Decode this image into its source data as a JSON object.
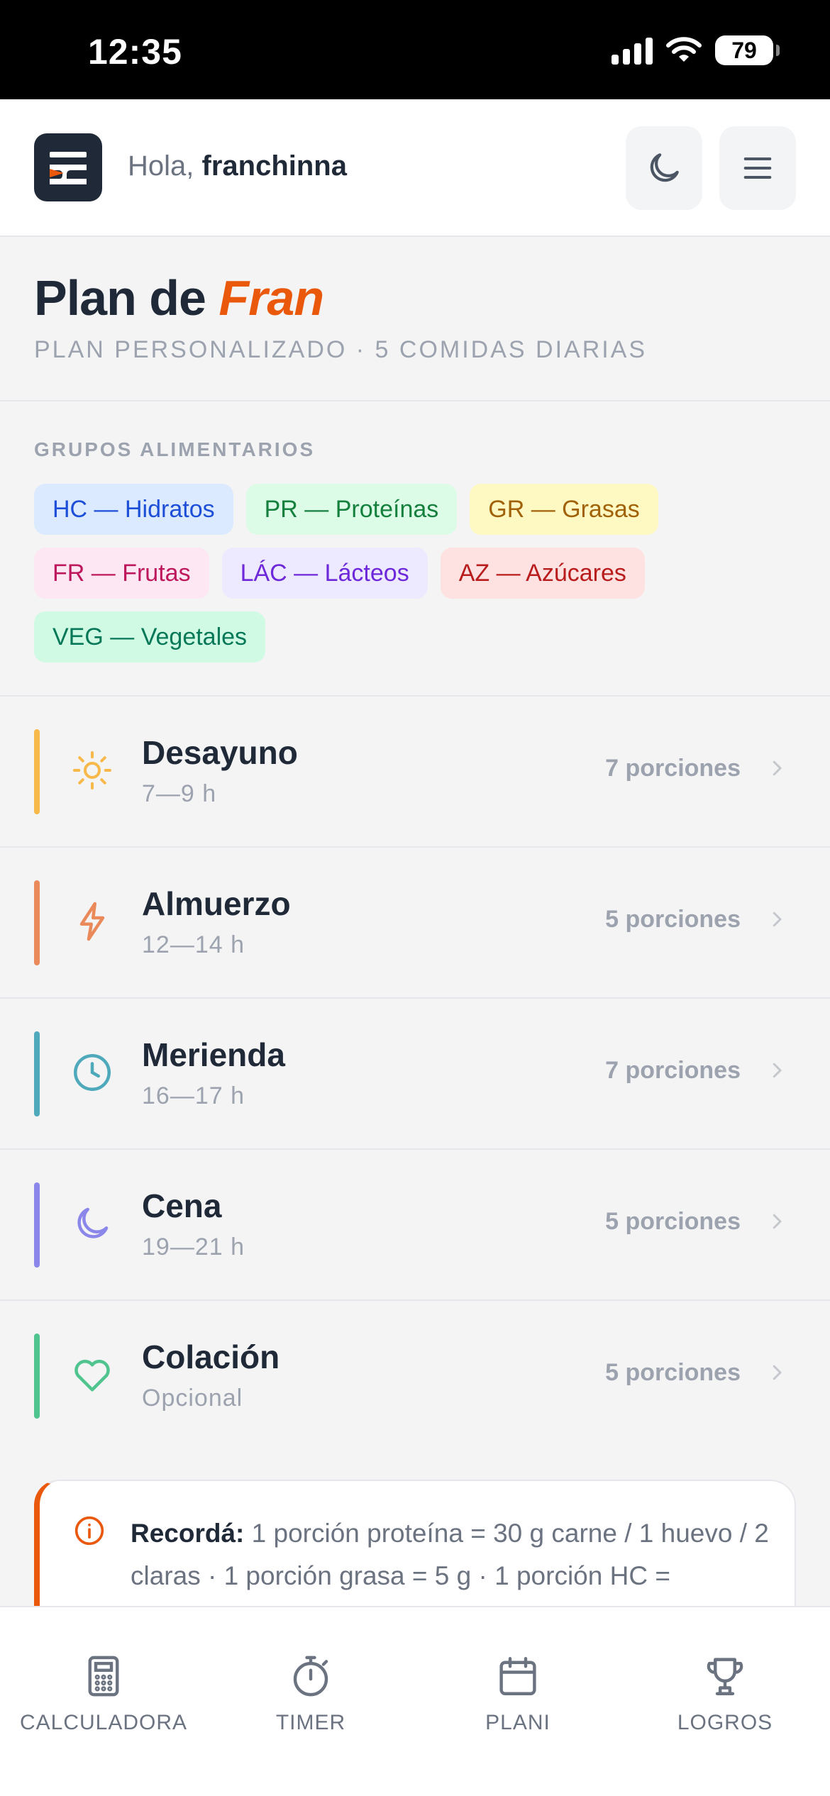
{
  "status_bar": {
    "time": "12:35",
    "battery": "79"
  },
  "header": {
    "greeting_prefix": "Hola,",
    "username": "franchinna"
  },
  "plan": {
    "title_prefix": "Plan de",
    "title_name": "Fran",
    "subtitle": "PLAN PERSONALIZADO · 5 COMIDAS DIARIAS"
  },
  "groups": {
    "label": "GRUPOS ALIMENTARIOS",
    "chips": [
      {
        "text": "HC — Hidratos",
        "bg": "#dbeafe",
        "color": "#1d4ed8"
      },
      {
        "text": "PR — Proteínas",
        "bg": "#dcfce7",
        "color": "#15803d"
      },
      {
        "text": "GR — Grasas",
        "bg": "#fef9c3",
        "color": "#a16207"
      },
      {
        "text": "FR — Frutas",
        "bg": "#fce7f3",
        "color": "#be185d"
      },
      {
        "text": "LÁC — Lácteos",
        "bg": "#ede9fe",
        "color": "#6d28d9"
      },
      {
        "text": "AZ — Azúcares",
        "bg": "#fee2e2",
        "color": "#b91c1c"
      },
      {
        "text": "VEG — Vegetales",
        "bg": "#d1fae5",
        "color": "#047857"
      }
    ]
  },
  "meals": [
    {
      "name": "Desayuno",
      "time": "7—9 h",
      "portions": "7 porciones",
      "icon": "sun-icon",
      "color": "#f6b94a"
    },
    {
      "name": "Almuerzo",
      "time": "12—14 h",
      "portions": "5 porciones",
      "icon": "lightning-icon",
      "color": "#ea8a5b"
    },
    {
      "name": "Merienda",
      "time": "16—17 h",
      "portions": "7 porciones",
      "icon": "clock-icon",
      "color": "#4ea9bb"
    },
    {
      "name": "Cena",
      "time": "19—21 h",
      "portions": "5 porciones",
      "icon": "moon-icon",
      "color": "#8b87ea"
    },
    {
      "name": "Colación",
      "time": "Opcional",
      "portions": "5 porciones",
      "icon": "heart-icon",
      "color": "#4fc48e"
    }
  ],
  "reminder": {
    "label": "Recordá:",
    "text": "1 porción proteína = 30 g carne / 1 huevo / 2 claras  ·  1 porción grasa = 5 g  ·  1 porción HC ="
  },
  "nav": [
    {
      "label": "CALCULADORA",
      "icon": "calculator-icon"
    },
    {
      "label": "TIMER",
      "icon": "stopwatch-icon"
    },
    {
      "label": "PLANI",
      "icon": "calendar-icon"
    },
    {
      "label": "LOGROS",
      "icon": "trophy-icon"
    }
  ],
  "colors": {
    "accent": "#ea580c",
    "dark": "#1f2937",
    "muted": "#9ca3af"
  }
}
